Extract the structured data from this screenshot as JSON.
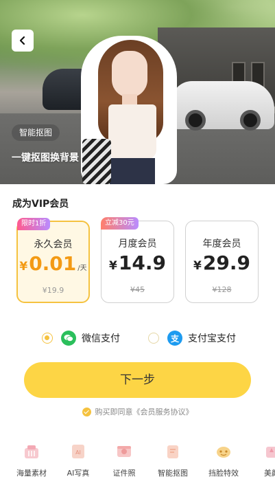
{
  "hero": {
    "tag": "智能抠图",
    "slogan": "一键抠图换背景"
  },
  "vip": {
    "title": "成为VIP会员",
    "plans": [
      {
        "badge": "限时1折",
        "name": "永久会员",
        "currency": "¥",
        "amount": "0.01",
        "unit": "/天",
        "original": "¥19.9",
        "selected": true
      },
      {
        "badge": "立减30元",
        "name": "月度会员",
        "currency": "¥",
        "amount": "14.9",
        "unit": "",
        "original": "¥45",
        "selected": false
      },
      {
        "badge": "",
        "name": "年度会员",
        "currency": "¥",
        "amount": "29.9",
        "unit": "",
        "original": "¥128",
        "selected": false
      }
    ]
  },
  "payment": {
    "options": [
      {
        "label": "微信支付",
        "icon": "wechat-pay-icon",
        "selected": true
      },
      {
        "label": "支付宝支付",
        "icon": "alipay-icon",
        "icon_glyph": "支",
        "selected": false
      }
    ]
  },
  "next_button": "下一步",
  "agreement": "购买即同意《会员服务协议》",
  "features": [
    {
      "label": "海量素材",
      "icon": "material-icon"
    },
    {
      "label": "AI写真",
      "icon": "ai-portrait-icon"
    },
    {
      "label": "证件照",
      "icon": "id-photo-icon"
    },
    {
      "label": "智能抠图",
      "icon": "smart-cutout-icon"
    },
    {
      "label": "挡脸特效",
      "icon": "face-effect-icon"
    },
    {
      "label": "美颜",
      "icon": "beauty-icon"
    }
  ],
  "colors": {
    "accent": "#fdd545",
    "price_highlight": "#f39a14",
    "wechat": "#2bbf5c",
    "alipay": "#1d9bf0"
  }
}
